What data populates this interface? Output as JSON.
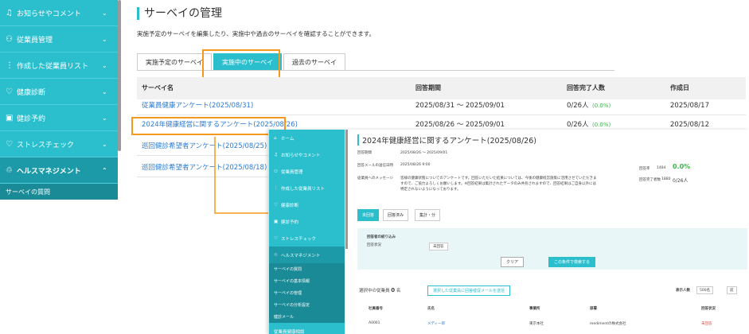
{
  "sidebar": {
    "items": [
      {
        "icon": "bell-icon",
        "glyph": "♫",
        "label": "お知らせやコメント",
        "chev": "⌄"
      },
      {
        "icon": "users-icon",
        "glyph": "⚇",
        "label": "従業員管理",
        "chev": "⌄"
      },
      {
        "icon": "list-icon",
        "glyph": "⋮",
        "label": "作成した従業員リスト",
        "chev": "⌄"
      },
      {
        "icon": "heart-icon",
        "glyph": "♡",
        "label": "健康診断",
        "chev": "⌄"
      },
      {
        "icon": "calendar-icon",
        "glyph": "▣",
        "label": "健診予約",
        "chev": "⌄"
      },
      {
        "icon": "heart-check-icon",
        "glyph": "♡",
        "label": "ストレスチェック",
        "chev": "⌄"
      },
      {
        "icon": "pulse-icon",
        "glyph": "♲",
        "label": "ヘルスマネジメント",
        "chev": "⌃"
      }
    ],
    "sub": "サーベイの質問"
  },
  "page": {
    "title": "サーベイの管理",
    "desc": "実施予定のサーベイを編集したり、実施中や過去のサーベイを確認することができます。"
  },
  "tabs": [
    "実施予定のサーベイ",
    "実施中のサーベイ",
    "過去のサーベイ"
  ],
  "table": {
    "headers": [
      "サーベイ名",
      "回答期間",
      "回答完了人数",
      "作成日"
    ],
    "rows": [
      {
        "name": "従業員健康アンケート(2025/08/31)",
        "period": "2025/08/31 ～ 2025/09/01",
        "done": "0/26人",
        "pct": "(0.0%)",
        "created": "2025/08/17"
      },
      {
        "name": "2024年健康経営に関するアンケート(2025/08/26)",
        "period": "2025/08/26 ～ 2025/09/01",
        "done": "0/26人",
        "pct": "(0.0%)",
        "created": "2025/08/12"
      },
      {
        "name": "巡回健診希望者アンケート(2025/08/25)",
        "period": "",
        "done": "",
        "pct": "",
        "created": ""
      },
      {
        "name": "巡回健診希望者アンケート(2025/08/18)",
        "period": "",
        "done": "",
        "pct": "",
        "created": ""
      }
    ]
  },
  "overlay": {
    "sidebar": [
      "ホーム",
      "お知らせやコメント",
      "従業員管理",
      "作成した従業員リスト",
      "健康診断",
      "健診予約",
      "ストレスチェック",
      "ヘルスマネジメント"
    ],
    "subs": [
      "サーベイの質問",
      "サーベイの基本情報",
      "サーベイの管理",
      "サーベイの分析設定",
      "健診メール"
    ],
    "last": "従業員健康相談",
    "title": "2024年健康経営に関するアンケート(2025/08/26)",
    "period_label": "回答期間",
    "period": "2025/08/26 ～ 2025/09/01",
    "deadline_label": "回答メールの送信日時",
    "deadline": "2025/08/26 9:00",
    "msg_label": "従業員へのメッセージ",
    "msg": "皆様の健康状態についてのアンケートです。回答いただいた結果については、今後の健康経営施策に活用させていただきますので、ご協力よろしくお願いします。※回答結果は集計されたデータのみ共有されますので、回答結果はご自身以外には特定されないようになっております。",
    "rate_label": "回答率",
    "rate_sub": "1484",
    "rate": "0.0%",
    "done_label": "回答完了者数",
    "done_sub": "1880",
    "done": "0/26人",
    "tabs": [
      "未回答",
      "回答済み",
      "集計・分"
    ],
    "filter_title": "回答者の絞り込み",
    "filter_label": "回答状況",
    "filter_value": "未回答",
    "clear": "クリア",
    "search": "この条件で検索する",
    "sel": "選択中の従業員",
    "sel_n": "0",
    "sel_unit": "名",
    "sel_btn": "選択した従業員に回答催促メールを送信",
    "count_label": "表示人数",
    "count": "500名",
    "prev": "前",
    "cols": [
      "社員番号",
      "氏名",
      "事業所",
      "部署",
      "回答状況"
    ],
    "r": {
      "id": "A0001",
      "name": "メディ一郎",
      "office": "東京本社",
      "dept": "medimentの株式会社",
      "status": "未回答"
    }
  }
}
